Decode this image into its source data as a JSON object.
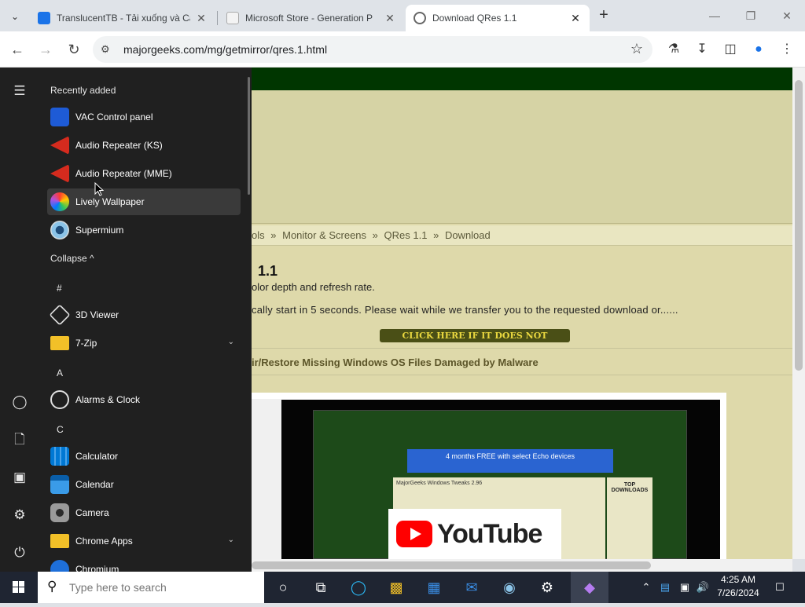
{
  "browser": {
    "tabs": [
      {
        "title": "TranslucentTB - Tải xuống và Cà",
        "favicon_color": "#1a73e8"
      },
      {
        "title": "Microsoft Store - Generation P",
        "favicon_color": "#f3f3f3"
      },
      {
        "title": "Download QRes 1.1",
        "favicon_color": "#888888",
        "active": true
      }
    ],
    "url": "majorgeeks.com/mg/getmirror/qres.1.html"
  },
  "page": {
    "breadcrumb": [
      "ols",
      "»",
      "Monitor & Screens",
      "»",
      "QRes 1.1",
      "»",
      "Download"
    ],
    "title": "1.1",
    "description": "olor depth and refresh rate.",
    "notice": "cally start in 5 seconds. Please wait while we transfer you to the requested download or......",
    "click_button": "CLICK HERE IF IT DOES NOT",
    "related_link": "ir/Restore Missing Windows OS Files Damaged by Malware",
    "video": {
      "ad_text": "4 months FREE with select Echo devices",
      "panel_title": "MajorGeeks Windows Tweaks 2.96",
      "sidebar_title": "TOP DOWNLOADS",
      "youtube_label": "YouTube"
    }
  },
  "start_menu": {
    "recently_added_label": "Recently added",
    "recent": [
      {
        "label": "VAC Control panel",
        "icon": "vac-icon",
        "color": "#1e5bd6"
      },
      {
        "label": "Audio Repeater (KS)",
        "icon": "audio-repeater-icon",
        "color": "#d52b1e"
      },
      {
        "label": "Audio Repeater (MME)",
        "icon": "audio-repeater-icon",
        "color": "#d52b1e"
      },
      {
        "label": "Lively Wallpaper",
        "icon": "lively-icon",
        "color": "#ff7a00"
      },
      {
        "label": "Supermium",
        "icon": "supermium-icon",
        "color": "#3b8fd4"
      }
    ],
    "collapse_label": "Collapse ^",
    "groups": [
      {
        "letter": "#",
        "apps": [
          {
            "label": "3D Viewer",
            "icon": "cube-icon",
            "color": "#e0e0e0"
          },
          {
            "label": "7-Zip",
            "icon": "folder-icon",
            "color": "#f2c028",
            "expandable": true
          }
        ]
      },
      {
        "letter": "A",
        "apps": [
          {
            "label": "Alarms & Clock",
            "icon": "clock-icon",
            "color": "#e0e0e0"
          }
        ]
      },
      {
        "letter": "C",
        "apps": [
          {
            "label": "Calculator",
            "icon": "calculator-icon",
            "color": "#0078d4"
          },
          {
            "label": "Calendar",
            "icon": "calendar-icon",
            "color": "#0078d4"
          },
          {
            "label": "Camera",
            "icon": "camera-icon",
            "color": "#6a6a6a"
          },
          {
            "label": "Chrome Apps",
            "icon": "folder-icon",
            "color": "#f2c028",
            "expandable": true
          },
          {
            "label": "Chromium",
            "icon": "chromium-icon",
            "color": "#1e6fd9"
          }
        ]
      }
    ]
  },
  "taskbar": {
    "search_placeholder": "Type here to search",
    "time": "4:25 AM",
    "date": "7/26/2024"
  }
}
